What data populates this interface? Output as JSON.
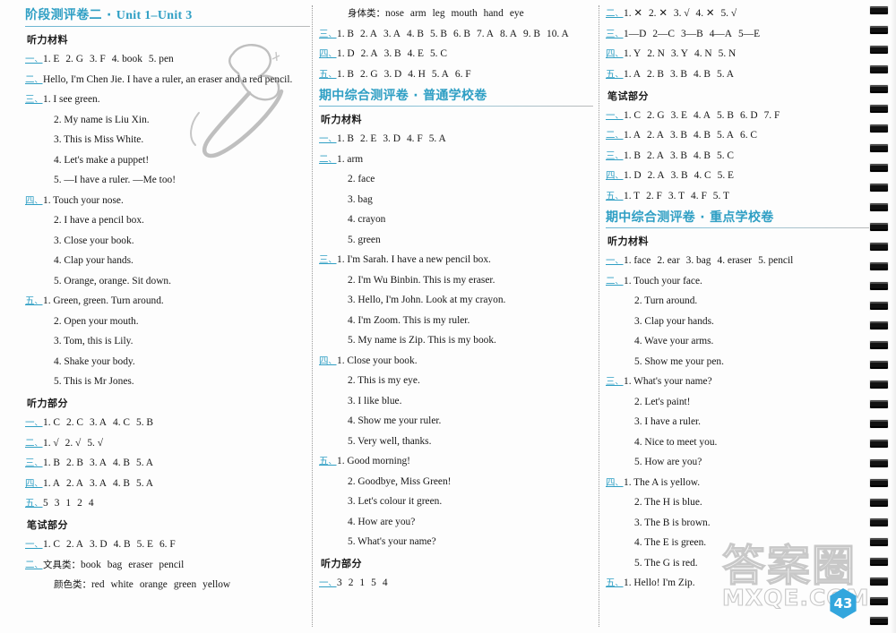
{
  "page": {
    "number": "43",
    "watermark_cn": "答案圈",
    "watermark_en": "MXQE.COM"
  },
  "columns": [
    {
      "id": "column-1",
      "blocks": [
        {
          "type": "section-heading",
          "cn": "阶段测评卷二",
          "sep": " · ",
          "en": "Unit 1–Unit 3"
        },
        {
          "type": "sub-heading",
          "text": "听力材料"
        },
        {
          "type": "line",
          "num": "一、",
          "body": "1. E　2. G　3. F　4. book　5. pen"
        },
        {
          "type": "line",
          "num": "二、",
          "body": "Hello, I'm Chen Jie. I have a ruler, an eraser and a red pencil."
        },
        {
          "type": "line",
          "num": "三、",
          "body": "1. I see green."
        },
        {
          "type": "line",
          "num": "",
          "body": "2. My name is Liu Xin."
        },
        {
          "type": "line",
          "num": "",
          "body": "3. This is Miss White."
        },
        {
          "type": "line",
          "num": "",
          "body": "4. Let's make a puppet!"
        },
        {
          "type": "line",
          "num": "",
          "body": "5. —I have a ruler. —Me too!"
        },
        {
          "type": "line",
          "num": "四、",
          "body": "1. Touch your nose."
        },
        {
          "type": "line",
          "num": "",
          "body": "2. I have a pencil box."
        },
        {
          "type": "line",
          "num": "",
          "body": "3. Close your book."
        },
        {
          "type": "line",
          "num": "",
          "body": "4. Clap your hands."
        },
        {
          "type": "line",
          "num": "",
          "body": "5. Orange, orange. Sit down."
        },
        {
          "type": "line",
          "num": "五、",
          "body": "1. Green, green. Turn around."
        },
        {
          "type": "line",
          "num": "",
          "body": "2. Open your mouth."
        },
        {
          "type": "line",
          "num": "",
          "body": "3. Tom, this is Lily."
        },
        {
          "type": "line",
          "num": "",
          "body": "4. Shake your body."
        },
        {
          "type": "line",
          "num": "",
          "body": "5. This is Mr Jones."
        },
        {
          "type": "sub-heading",
          "text": "听力部分"
        },
        {
          "type": "line",
          "num": "一、",
          "body": "1. C　2. C　3. A　4. C　5. B"
        },
        {
          "type": "line",
          "num": "二、",
          "body": "1. √　2. √　5. √"
        },
        {
          "type": "line",
          "num": "三、",
          "body": "1. B　2. B　3. A　4. B　5. A"
        },
        {
          "type": "line",
          "num": "四、",
          "body": "1. A　2. A　3. A　4. B　5. A"
        },
        {
          "type": "line",
          "num": "五、",
          "body": "5　3　1　2　4"
        },
        {
          "type": "sub-heading",
          "text": "笔试部分"
        },
        {
          "type": "line",
          "num": "一、",
          "body": "1. C　2. A　3. D　4. B　5. E　6. F"
        },
        {
          "type": "line",
          "num": "二、",
          "body": "文具类：book　bag　eraser　pencil"
        },
        {
          "type": "line",
          "num": "",
          "body": "颜色类：red　white　orange　green　yellow"
        }
      ]
    },
    {
      "id": "column-2",
      "blocks": [
        {
          "type": "line",
          "num": "",
          "body": "身体类：nose　arm　leg　mouth　hand　eye"
        },
        {
          "type": "line",
          "num": "三、",
          "body": "1. B　2. A　3. A　4. B　5. B　6. B　7. A　8. A　9. B　10. A"
        },
        {
          "type": "line",
          "num": "四、",
          "body": "1. D　2. A　3. B　4. E　5. C"
        },
        {
          "type": "line",
          "num": "五、",
          "body": "1. B　2. G　3. D　4. H　5. A　6. F"
        },
        {
          "type": "section-heading",
          "cn": "期中综合测评卷",
          "sep": " · ",
          "en": "普通学校卷"
        },
        {
          "type": "sub-heading",
          "text": "听力材料"
        },
        {
          "type": "line",
          "num": "一、",
          "body": "1. B　2. E　3. D　4. F　5. A"
        },
        {
          "type": "line",
          "num": "二、",
          "body": "1. arm"
        },
        {
          "type": "line",
          "num": "",
          "body": "2. face"
        },
        {
          "type": "line",
          "num": "",
          "body": "3. bag"
        },
        {
          "type": "line",
          "num": "",
          "body": "4. crayon"
        },
        {
          "type": "line",
          "num": "",
          "body": "5. green"
        },
        {
          "type": "line",
          "num": "三、",
          "body": "1. I'm Sarah.  I have a new pencil box."
        },
        {
          "type": "line",
          "num": "",
          "body": "2. I'm Wu Binbin.  This is my eraser."
        },
        {
          "type": "line",
          "num": "",
          "body": "3. Hello, I'm John.  Look at my crayon."
        },
        {
          "type": "line",
          "num": "",
          "body": "4. I'm Zoom.  This is my ruler."
        },
        {
          "type": "line",
          "num": "",
          "body": "5. My name is Zip. This is my book."
        },
        {
          "type": "line",
          "num": "四、",
          "body": "1. Close your book."
        },
        {
          "type": "line",
          "num": "",
          "body": "2. This is my eye."
        },
        {
          "type": "line",
          "num": "",
          "body": "3. I like blue."
        },
        {
          "type": "line",
          "num": "",
          "body": "4. Show me your ruler."
        },
        {
          "type": "line",
          "num": "",
          "body": "5. Very well, thanks."
        },
        {
          "type": "line",
          "num": "五、",
          "body": "1. Good morning!"
        },
        {
          "type": "line",
          "num": "",
          "body": "2. Goodbye, Miss Green!"
        },
        {
          "type": "line",
          "num": "",
          "body": "3. Let's colour it green."
        },
        {
          "type": "line",
          "num": "",
          "body": "4. How are you?"
        },
        {
          "type": "line",
          "num": "",
          "body": "5. What's your name?"
        },
        {
          "type": "sub-heading",
          "text": "听力部分"
        },
        {
          "type": "line",
          "num": "一、",
          "body": "3　2　1　5　4"
        }
      ]
    },
    {
      "id": "column-3",
      "blocks": [
        {
          "type": "line",
          "num": "二、",
          "body": "1. ✕　2. ✕　3. √　4. ✕　5. √"
        },
        {
          "type": "line",
          "num": "三、",
          "body": "1—D　2—C　3—B　4—A　5—E"
        },
        {
          "type": "line",
          "num": "四、",
          "body": "1. Y　2. N　3. Y　4. N　5. N"
        },
        {
          "type": "line",
          "num": "五、",
          "body": "1. A　2. B　3. B　4. B　5. A"
        },
        {
          "type": "sub-heading",
          "text": "笔试部分"
        },
        {
          "type": "line",
          "num": "一、",
          "body": "1. C　2. G　3. E　4. A　5. B　6. D　7. F"
        },
        {
          "type": "line",
          "num": "二、",
          "body": "1. A　2. A　3. B　4. B　5. A　6. C"
        },
        {
          "type": "line",
          "num": "三、",
          "body": "1. B　2. A　3. B　4. B　5. C"
        },
        {
          "type": "line",
          "num": "四、",
          "body": "1. D　2. A　3. B　4. C　5. E"
        },
        {
          "type": "line",
          "num": "五、",
          "body": "1. T　2. F　3. T　4. F　5. T"
        },
        {
          "type": "section-heading",
          "cn": "期中综合测评卷",
          "sep": " · ",
          "en": "重点学校卷"
        },
        {
          "type": "sub-heading",
          "text": "听力材料"
        },
        {
          "type": "line",
          "num": "一、",
          "body": "1. face　2. ear　3. bag　4. eraser　5. pencil"
        },
        {
          "type": "line",
          "num": "二、",
          "body": "1. Touch your face."
        },
        {
          "type": "line",
          "num": "",
          "body": "2. Turn around."
        },
        {
          "type": "line",
          "num": "",
          "body": "3. Clap your hands."
        },
        {
          "type": "line",
          "num": "",
          "body": "4. Wave your arms."
        },
        {
          "type": "line",
          "num": "",
          "body": "5. Show me your pen."
        },
        {
          "type": "line",
          "num": "三、",
          "body": "1. What's your name?"
        },
        {
          "type": "line",
          "num": "",
          "body": "2. Let's paint!"
        },
        {
          "type": "line",
          "num": "",
          "body": "3. I have a ruler."
        },
        {
          "type": "line",
          "num": "",
          "body": "4. Nice to meet you."
        },
        {
          "type": "line",
          "num": "",
          "body": "5. How are you?"
        },
        {
          "type": "line",
          "num": "四、",
          "body": "1. The A is yellow."
        },
        {
          "type": "line",
          "num": "",
          "body": "2. The H is blue."
        },
        {
          "type": "line",
          "num": "",
          "body": "3. The B is brown."
        },
        {
          "type": "line",
          "num": "",
          "body": "4. The E is green."
        },
        {
          "type": "line",
          "num": "",
          "body": "5. The G is red."
        },
        {
          "type": "line",
          "num": "五、",
          "body": "1. Hello! I'm Zip."
        }
      ]
    }
  ]
}
